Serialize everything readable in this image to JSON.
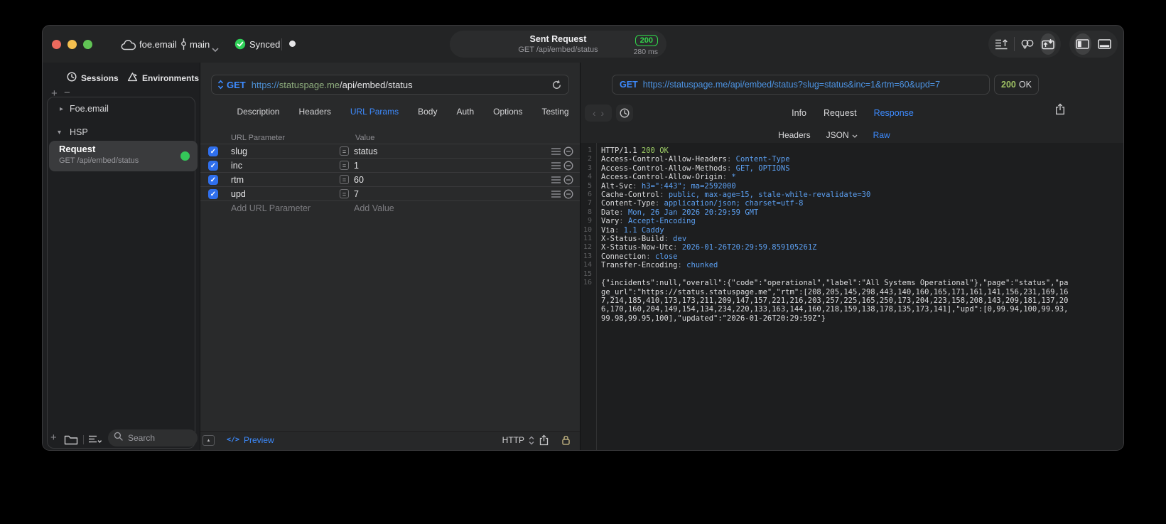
{
  "titlebar": {
    "project": "foe.email",
    "branch": "main",
    "sync_label": "Synced",
    "title": "Sent Request",
    "subtitle": "GET /api/embed/status",
    "status_code": "200",
    "duration": "280 ms"
  },
  "sidebar": {
    "tabs": [
      {
        "label": "Sessions"
      },
      {
        "label": "Environments"
      }
    ],
    "tree": [
      {
        "label": "Foe.email"
      },
      {
        "label": "HSP"
      }
    ],
    "request": {
      "title": "Request",
      "subtitle": "GET /api/embed/status"
    },
    "search_placeholder": "Search"
  },
  "request_editor": {
    "method": "GET",
    "url_scheme": "https://",
    "url_host": "statuspage.me",
    "url_path": "/api/embed/status",
    "tabs": [
      "Description",
      "Headers",
      "URL Params",
      "Body",
      "Auth",
      "Options",
      "Testing"
    ],
    "active_tab": "URL Params",
    "table": {
      "col_param": "URL Parameter",
      "col_value": "Value",
      "rows": [
        {
          "name": "slug",
          "value": "status",
          "enabled": true
        },
        {
          "name": "inc",
          "value": "1",
          "enabled": true
        },
        {
          "name": "rtm",
          "value": "60",
          "enabled": true
        },
        {
          "name": "upd",
          "value": "7",
          "enabled": true
        }
      ],
      "add_param": "Add URL Parameter",
      "add_value": "Add Value"
    },
    "footer": {
      "preview_icon": "</>",
      "preview": "Preview",
      "protocol": "HTTP"
    }
  },
  "response_viewer": {
    "method": "GET",
    "url": "https://statuspage.me/api/embed/status?slug=status&inc=1&rtm=60&upd=7",
    "status_code": "200",
    "status_text": "OK",
    "tabs": [
      "Info",
      "Request",
      "Response"
    ],
    "active_tab": "Response",
    "format_tabs": [
      "Headers",
      "JSON",
      "Raw"
    ],
    "active_format": "Raw",
    "lines": [
      {
        "n": "1",
        "type": "status",
        "prefix": "HTTP/1.1 ",
        "status": "200 OK"
      },
      {
        "n": "2",
        "type": "header",
        "name": "Access-Control-Allow-Headers",
        "value": "Content-Type"
      },
      {
        "n": "3",
        "type": "header",
        "name": "Access-Control-Allow-Methods",
        "value": "GET, OPTIONS"
      },
      {
        "n": "4",
        "type": "header",
        "name": "Access-Control-Allow-Origin",
        "value": "*"
      },
      {
        "n": "5",
        "type": "header",
        "name": "Alt-Svc",
        "value": "h3=\":443\"; ma=2592000"
      },
      {
        "n": "6",
        "type": "header",
        "name": "Cache-Control",
        "value": "public, max-age=15, stale-while-revalidate=30"
      },
      {
        "n": "7",
        "type": "header",
        "name": "Content-Type",
        "value": "application/json; charset=utf-8"
      },
      {
        "n": "8",
        "type": "header",
        "name": "Date",
        "value": "Mon, 26 Jan 2026 20:29:59 GMT"
      },
      {
        "n": "9",
        "type": "header",
        "name": "Vary",
        "value": "Accept-Encoding"
      },
      {
        "n": "10",
        "type": "header",
        "name": "Via",
        "value": "1.1 Caddy"
      },
      {
        "n": "11",
        "type": "header",
        "name": "X-Status-Build",
        "value": "dev"
      },
      {
        "n": "12",
        "type": "header",
        "name": "X-Status-Now-Utc",
        "value": "2026-01-26T20:29:59.859105261Z"
      },
      {
        "n": "13",
        "type": "header",
        "name": "Connection",
        "value": "close"
      },
      {
        "n": "14",
        "type": "header",
        "name": "Transfer-Encoding",
        "value": "chunked"
      },
      {
        "n": "15",
        "type": "blank"
      },
      {
        "n": "16",
        "type": "body",
        "text": "{\"incidents\":null,\"overall\":{\"code\":\"operational\",\"label\":\"All Systems Operational\"},\"page\":\"status\",\"page_url\":\"https://status.statuspage.me\",\"rtm\":[208,205,145,298,443,140,160,165,171,161,141,156,231,169,167,214,185,410,173,173,211,209,147,157,221,216,203,257,225,165,250,173,204,223,158,208,143,209,181,137,206,170,160,204,149,154,134,234,220,133,163,144,160,218,159,138,178,135,173,141],\"upd\":[0,99.94,100,99.93,99.98,99.95,100],\"updated\":\"2026-01-26T20:29:59Z\"}"
      }
    ]
  },
  "colors": {
    "accent_blue": "#3d8bff",
    "value_blue": "#5ca0f2",
    "host_green": "#8fae7e",
    "badge_green": "#32d74b",
    "code_green": "#9ccc65",
    "checkbox_blue": "#2f6fed",
    "status_dot_green": "#34c759"
  }
}
